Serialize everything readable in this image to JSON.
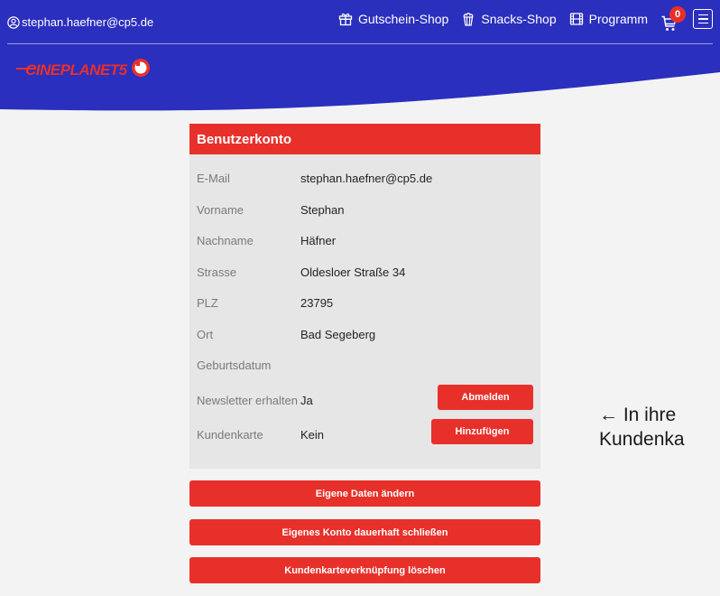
{
  "header": {
    "user_email": "stephan.haefner@cp5.de",
    "nav": [
      {
        "label": "Gutschein-Shop",
        "icon": "gift-icon"
      },
      {
        "label": "Snacks-Shop",
        "icon": "popcorn-icon"
      },
      {
        "label": "Programm",
        "icon": "film-icon"
      }
    ],
    "cart_count": "0",
    "logo_text": "CINEPLANET5"
  },
  "account": {
    "title": "Benutzerkonto",
    "fields": [
      {
        "label": "E-Mail",
        "value": "stephan.haefner@cp5.de"
      },
      {
        "label": "Vorname",
        "value": "Stephan"
      },
      {
        "label": "Nachname",
        "value": "Häfner"
      },
      {
        "label": "Strasse",
        "value": "Oldesloer Straße 34"
      },
      {
        "label": "PLZ",
        "value": "23795"
      },
      {
        "label": "Ort",
        "value": "Bad Segeberg"
      },
      {
        "label": "Geburtsdatum",
        "value": ""
      }
    ],
    "newsletter": {
      "label": "Newsletter erhalten",
      "value": "Ja",
      "button": "Abmelden"
    },
    "customer_card": {
      "label": "Kundenkarte",
      "value": "Kein",
      "button": "Hinzufügen"
    }
  },
  "actions": {
    "edit_data": "Eigene Daten ändern",
    "close_account": "Eigenes Konto dauerhaft schließen",
    "delete_card_link": "Kundenkarteverknüpfung löschen"
  },
  "side_note": {
    "line1": "← In ihre",
    "line2": "Kundenka"
  },
  "colors": {
    "brand_blue": "#2b2fbd",
    "brand_red": "#e8302a",
    "panel_bg": "#e6e6e6",
    "page_bg": "#f3f3f3"
  }
}
